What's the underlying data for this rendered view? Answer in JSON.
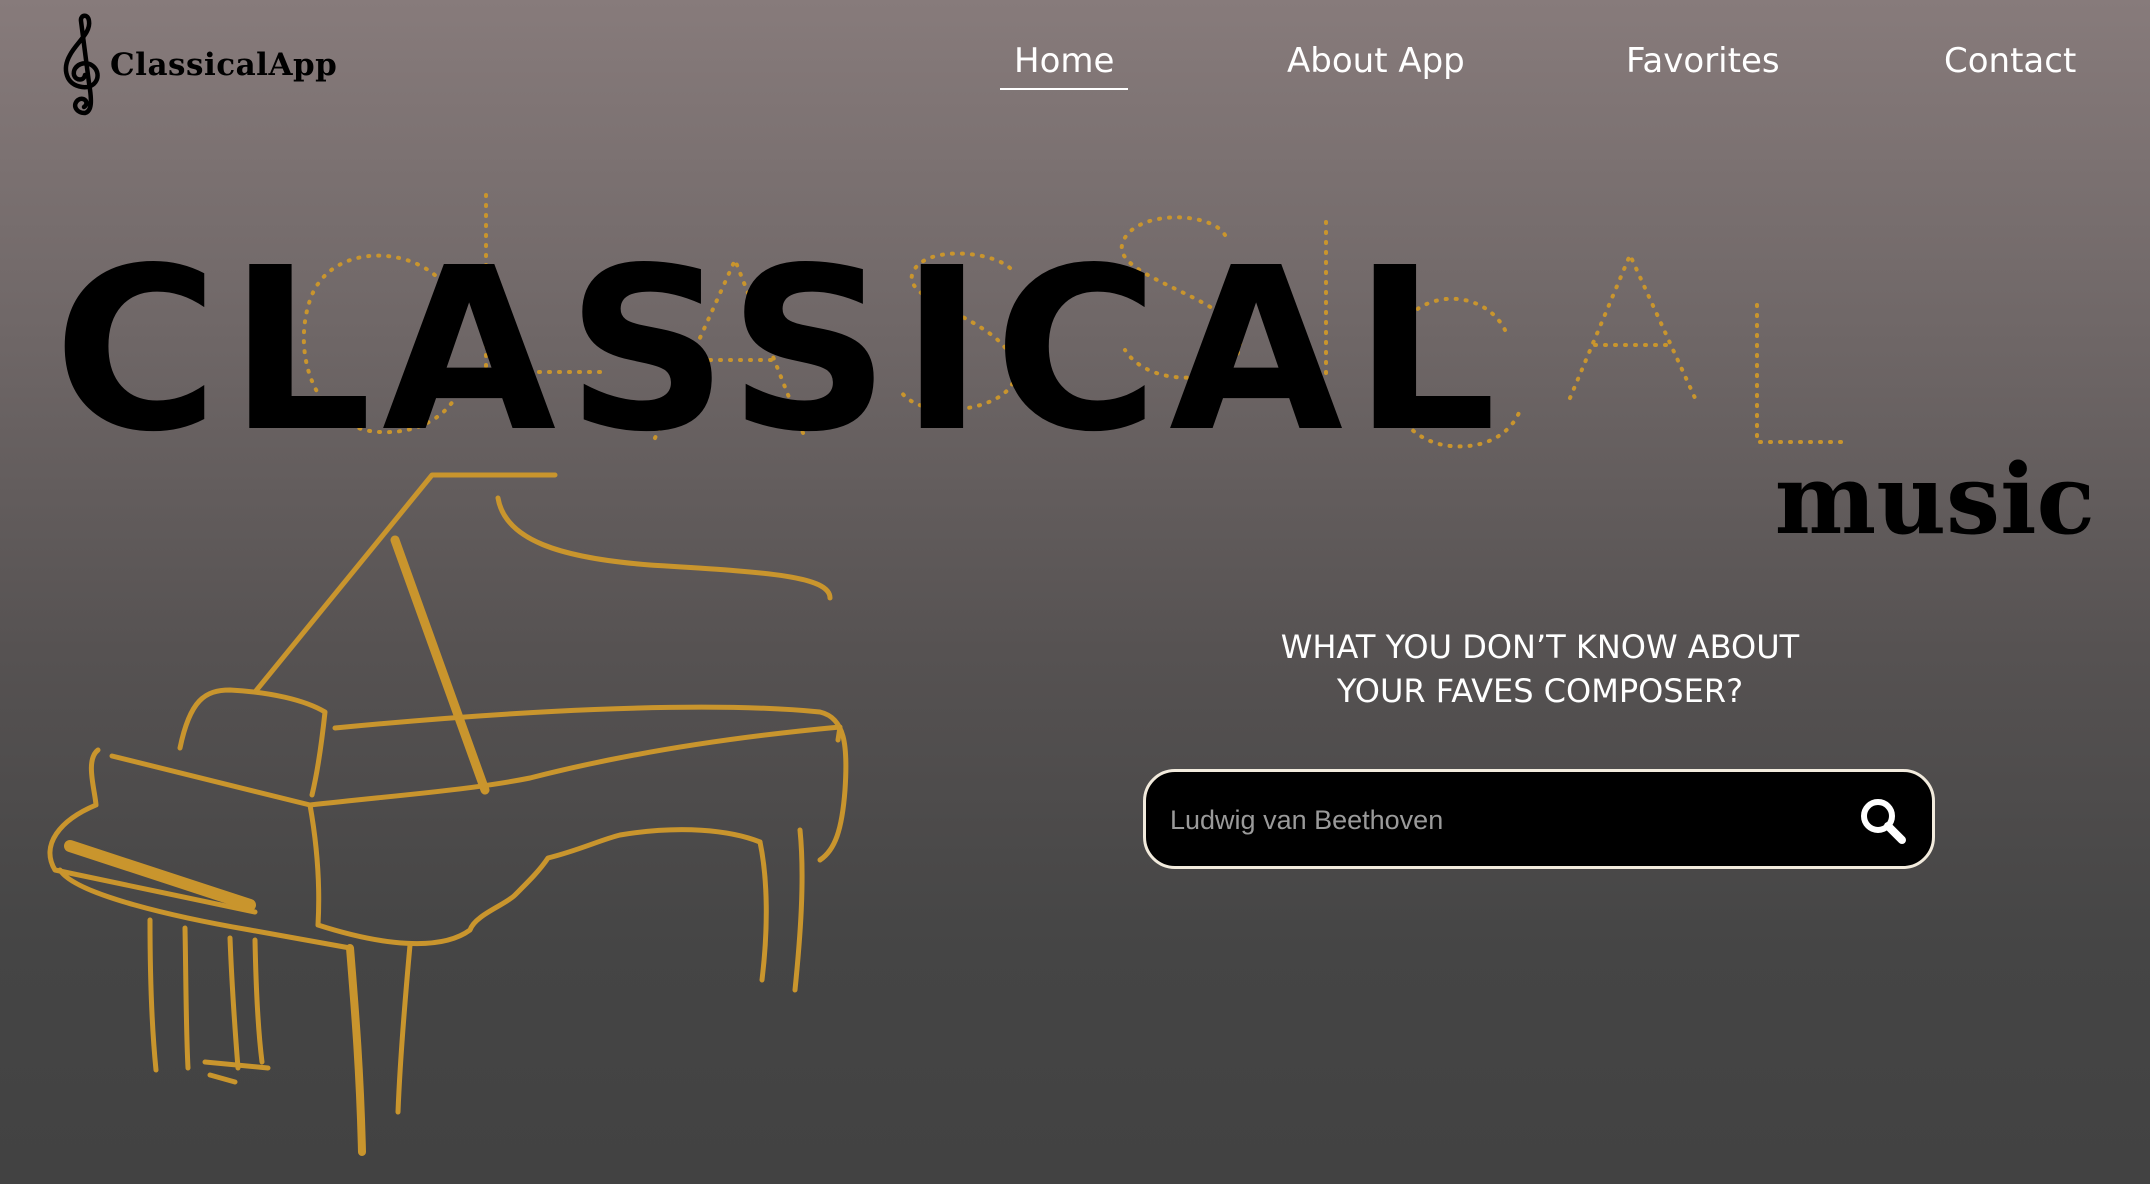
{
  "header": {
    "brand": "ClassicalApp",
    "logo_icon": "treble-clef-icon",
    "nav": [
      {
        "label": "Home",
        "active": true
      },
      {
        "label": "About App",
        "active": false
      },
      {
        "label": "Favorites",
        "active": false
      },
      {
        "label": "Contact",
        "active": false
      }
    ]
  },
  "hero": {
    "title": "CLASSICAL",
    "subtitle": "music",
    "illustration": "grand-piano-illustration",
    "question_line1": "WHAT YOU DON’T KNOW ABOUT",
    "question_line2": "YOUR FAVES COMPOSER?"
  },
  "search": {
    "placeholder": "Ludwig van Beethoven",
    "value": "",
    "button_icon": "search-icon"
  },
  "colors": {
    "accent_gold": "#c9952d",
    "text_light": "#ffffff",
    "title_black": "#000000",
    "search_border": "#f2ebdd"
  }
}
